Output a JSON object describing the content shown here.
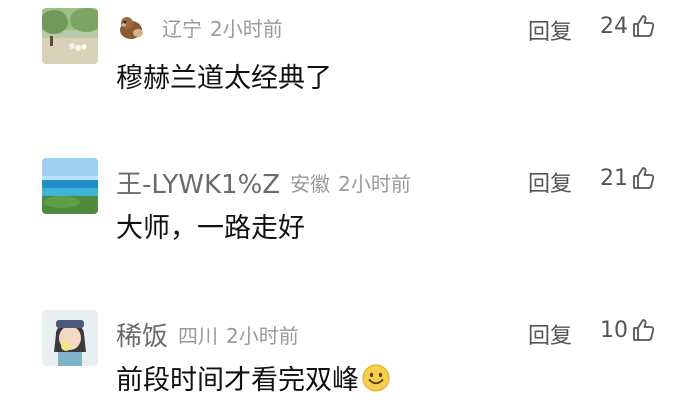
{
  "comments": [
    {
      "user": "",
      "location": "辽宁",
      "time": "2小时前",
      "text": "穆赫兰道太经典了",
      "reply_label": "回复",
      "likes": "24",
      "avatar_icon": "park-scene-avatar",
      "name_icon": "otter-emoji-icon"
    },
    {
      "user": "王-LYWK1%Z",
      "location": "安徽",
      "time": "2小时前",
      "text": "大师，一路走好",
      "reply_label": "回复",
      "likes": "21",
      "avatar_icon": "ocean-beach-avatar"
    },
    {
      "user": "稀饭",
      "location": "四川",
      "time": "2小时前",
      "text": "前段时间才看完双峰",
      "reply_label": "回复",
      "likes": "10",
      "avatar_icon": "cartoon-girl-avatar",
      "text_emoji": "smile-emoji-icon"
    }
  ],
  "colors": {
    "meta": "#9a9a9a",
    "name": "#6b6b6b",
    "text": "#111111",
    "action": "#555555"
  }
}
